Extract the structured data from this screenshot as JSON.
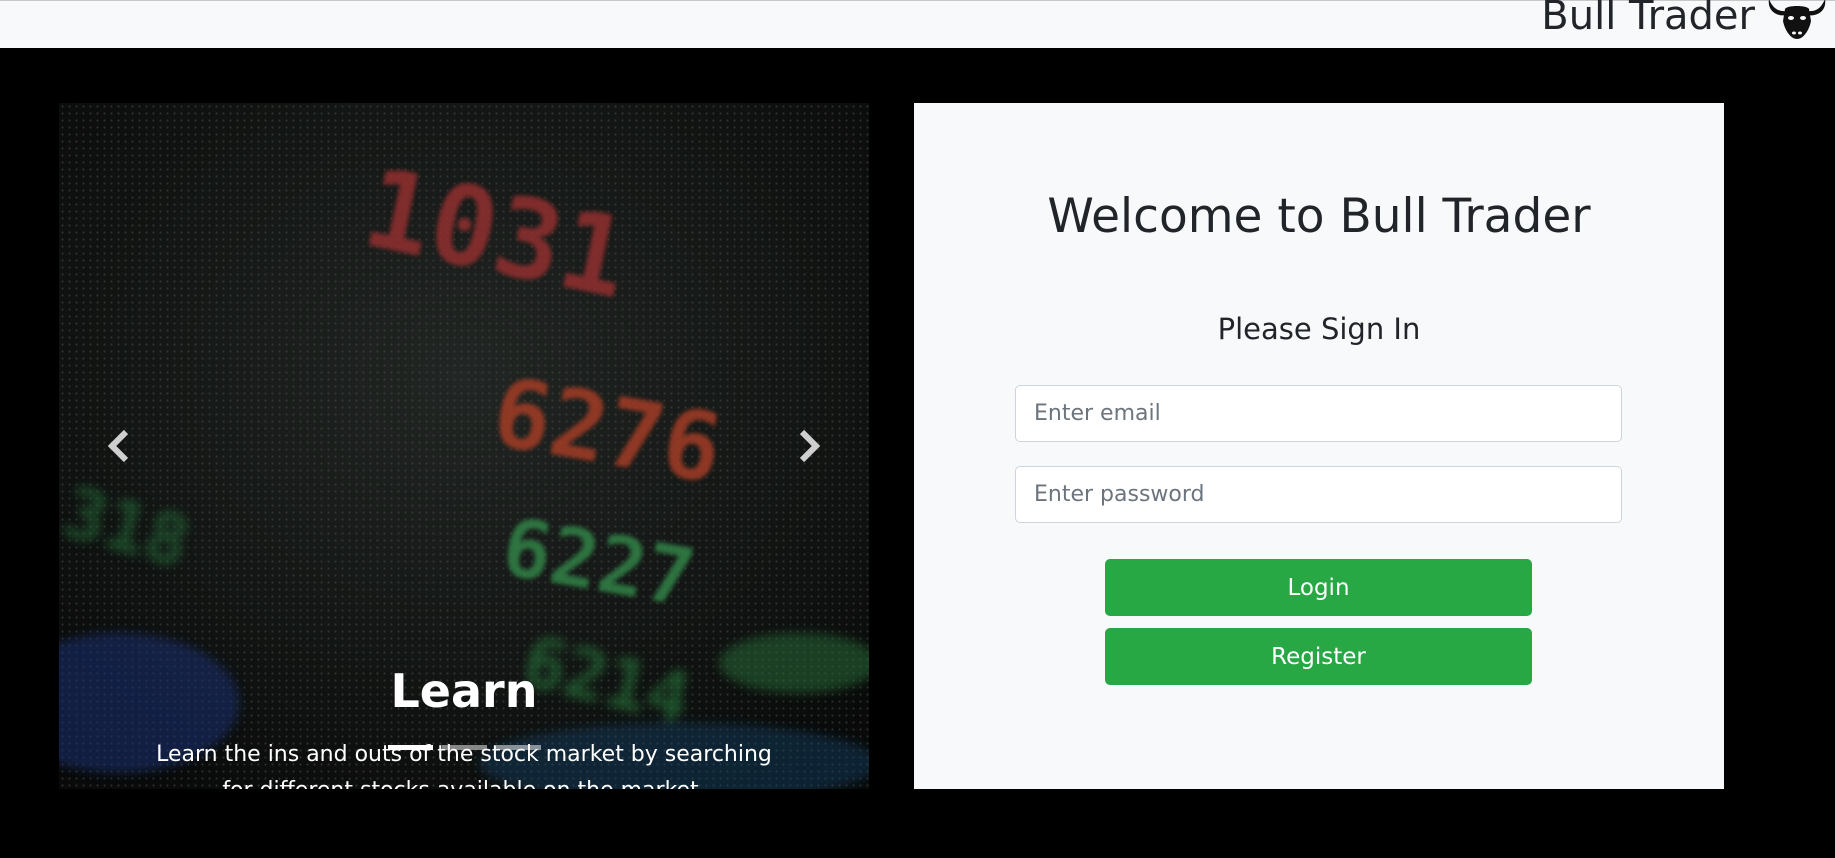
{
  "navbar": {
    "brand": "Bull Trader",
    "logo_icon": "bull-head-icon"
  },
  "carousel": {
    "slides": [
      {
        "title": "Learn",
        "text": "Learn the ins and outs of the stock market by searching for different stocks available on the market."
      }
    ],
    "indicator_count": 3,
    "active_index": 0,
    "prev_icon": "chevron-left-icon",
    "next_icon": "chevron-right-icon",
    "background_numbers": [
      "1031",
      "6276",
      "6227",
      "6214",
      "318"
    ]
  },
  "login": {
    "heading": "Welcome to Bull Trader",
    "subheading": "Please Sign In",
    "email_placeholder": "Enter email",
    "password_placeholder": "Enter password",
    "login_label": "Login",
    "register_label": "Register"
  },
  "colors": {
    "success": "#28a745",
    "light": "#f8f9fa",
    "dark_text": "#212529"
  }
}
